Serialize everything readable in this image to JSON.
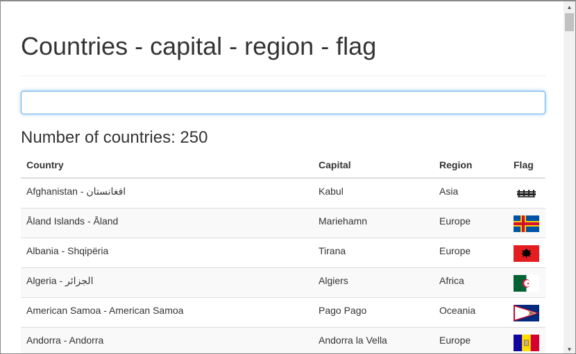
{
  "page": {
    "title": "Countries - capital - region - flag",
    "search_value": "",
    "count_label": "Number of countries: 250"
  },
  "table": {
    "headers": [
      "Country",
      "Capital",
      "Region",
      "Flag"
    ],
    "rows": [
      {
        "country": "Afghanistan - افغانستان",
        "capital": "Kabul",
        "region": "Asia",
        "flag": "afghanistan-flag"
      },
      {
        "country": "Åland Islands - Åland",
        "capital": "Mariehamn",
        "region": "Europe",
        "flag": "aland-flag"
      },
      {
        "country": "Albania - Shqipëria",
        "capital": "Tirana",
        "region": "Europe",
        "flag": "albania-flag"
      },
      {
        "country": "Algeria - الجزائر",
        "capital": "Algiers",
        "region": "Africa",
        "flag": "algeria-flag"
      },
      {
        "country": "American Samoa - American Samoa",
        "capital": "Pago Pago",
        "region": "Oceania",
        "flag": "american-samoa-flag"
      },
      {
        "country": "Andorra - Andorra",
        "capital": "Andorra la Vella",
        "region": "Europe",
        "flag": "andorra-flag"
      }
    ]
  },
  "scrollbar": {
    "up": "▲",
    "down": "▼"
  }
}
